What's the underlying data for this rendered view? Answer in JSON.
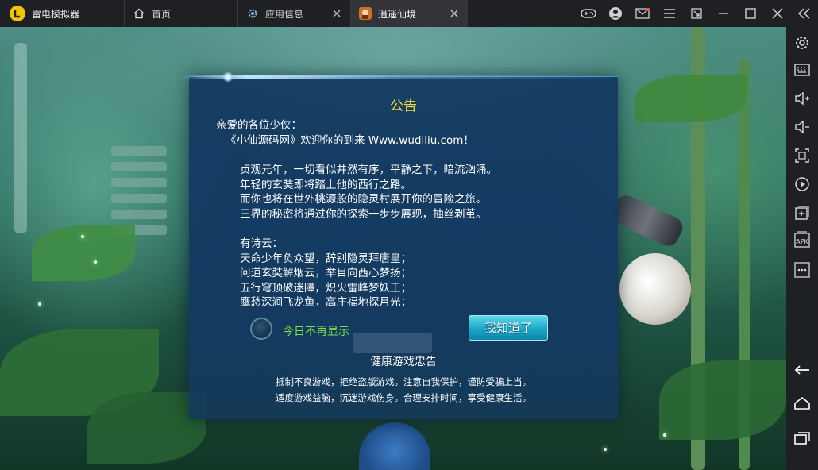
{
  "app": {
    "name": "雷电模拟器",
    "tabs": [
      {
        "label": "首页",
        "icon": "home-icon"
      },
      {
        "label": "应用信息",
        "icon": "settings-gear-icon"
      },
      {
        "label": "逍遥仙境",
        "icon": "game-app-icon",
        "active": true
      }
    ]
  },
  "titlebar_icons": [
    "gamepad-icon",
    "user-avatar-icon",
    "mail-icon",
    "menu-icon",
    "restore-icon",
    "minimize-icon",
    "maximize-icon",
    "close-icon",
    "collapse-sidebar-icon"
  ],
  "sidebar": {
    "items": [
      "settings-icon",
      "keyboard-icon",
      "volume-up-icon",
      "volume-down-icon",
      "fullscreen-icon",
      "record-icon",
      "add-app-icon",
      "apk-install-icon",
      "more-icon",
      "back-icon",
      "home-icon",
      "recent-apps-icon"
    ],
    "apk_label": "APK"
  },
  "notice": {
    "title": "公告",
    "greeting": "亲爱的各位少侠：",
    "welcome": "《小仙源码网》欢迎你的到来 Www.wudiliu.com！",
    "story": [
      "贞观元年，一切看似井然有序，平静之下，暗流汹涌。",
      "年轻的玄奘即将踏上他的西行之路。",
      "而你也将在世外桃源般的隐灵村展开你的冒险之旅。",
      "三界的秘密将通过你的探索一步步展现，抽丝剥茧。"
    ],
    "poem_title": "有诗云：",
    "poem": [
      "天命少年负众望，辞别隐灵拜唐皇；",
      "问道玄奘解烟云，举目向西心梦扬；",
      "五行穹顶破迷障，炽火雷峰梦妖王；",
      "鹰愁深涧飞龙鱼，高庄福地探月光；"
    ],
    "dont_show_today": "今日不再显示",
    "ok_button": "我知道了"
  },
  "health": {
    "title": "健康游戏忠告",
    "line1": "抵制不良游戏，拒绝盗版游戏。注意自我保护，谨防受骗上当。",
    "line2": "适度游戏益脑，沉迷游戏伤身。合理安排时间，享受健康生活。"
  },
  "colors": {
    "titlebar_bg": "#1f2024",
    "notice_title": "#f3d83a",
    "toggle_label": "#7be04a",
    "ok_button": "#1aa6c8"
  }
}
